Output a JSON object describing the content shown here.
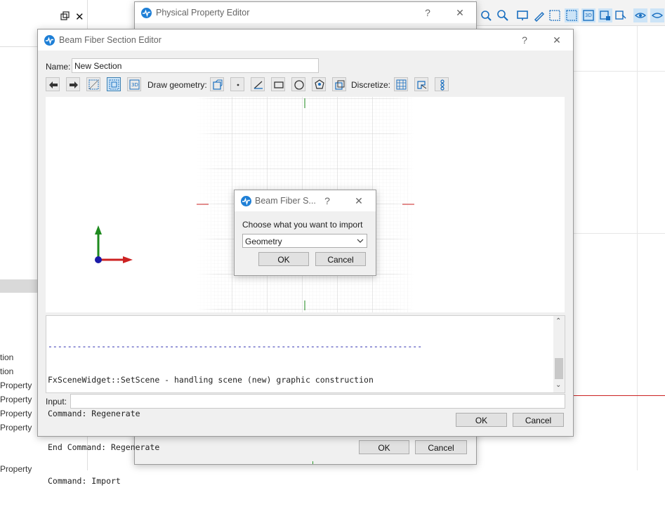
{
  "background": {
    "tree_items": [
      "tion",
      "tion",
      "Property",
      "Property",
      "Property",
      "Property",
      "Property"
    ]
  },
  "physical_window": {
    "title": "Physical Property Editor",
    "help_glyph": "?",
    "close_glyph": "✕",
    "ok_label": "OK",
    "cancel_label": "Cancel"
  },
  "beam_window": {
    "title": "Beam Fiber Section Editor",
    "help_glyph": "?",
    "close_glyph": "✕",
    "name_label": "Name:",
    "name_value": "New Section",
    "draw_geometry_label": "Draw geometry:",
    "discretize_label": "Discretize:",
    "console_lines": [
      "-----------------------------------------------------------------------------",
      "FxSceneWidget::SetScene - handling scene (new) graphic construction",
      "Command: Regenerate",
      "End Command: Regenerate",
      "Command: Import"
    ],
    "input_label": "Input:",
    "input_value": "",
    "ok_label": "OK",
    "cancel_label": "Cancel"
  },
  "import_dialog": {
    "title": "Beam Fiber S...",
    "help_glyph": "?",
    "close_glyph": "✕",
    "prompt": "Choose what you want to import",
    "selected_option": "Geometry",
    "ok_label": "OK",
    "cancel_label": "Cancel"
  },
  "colors": {
    "accent": "#1e7fd6",
    "axis_x": "#cc2222",
    "axis_y": "#1e8a1e",
    "axis_origin": "#1a1aa8"
  }
}
